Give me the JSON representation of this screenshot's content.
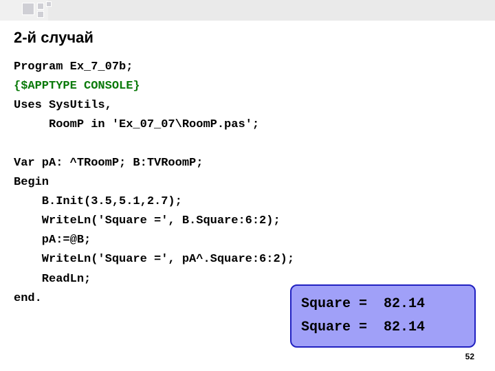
{
  "title": "2-й случай",
  "code": {
    "l1": "Program Ex_7_07b;",
    "l2": "{$APPTYPE CONSOLE}",
    "l3": "Uses SysUtils,",
    "l4": "     RoomP in 'Ex_07_07\\RoomP.pas';",
    "l5": "",
    "l6": "Var pA: ^TRoomP; B:TVRoomP;",
    "l7": "Begin",
    "l8": "    B.Init(3.5,5.1,2.7);",
    "l9": "    WriteLn('Square =', B.Square:6:2);",
    "l10": "    pA:=@B;",
    "l11": "    WriteLn('Square =', pA^.Square:6:2);",
    "l12": "    ReadLn;",
    "l13": "end."
  },
  "output": {
    "line1": "Square =  82.14",
    "line2": "Square =  82.14"
  },
  "page_number": "52"
}
